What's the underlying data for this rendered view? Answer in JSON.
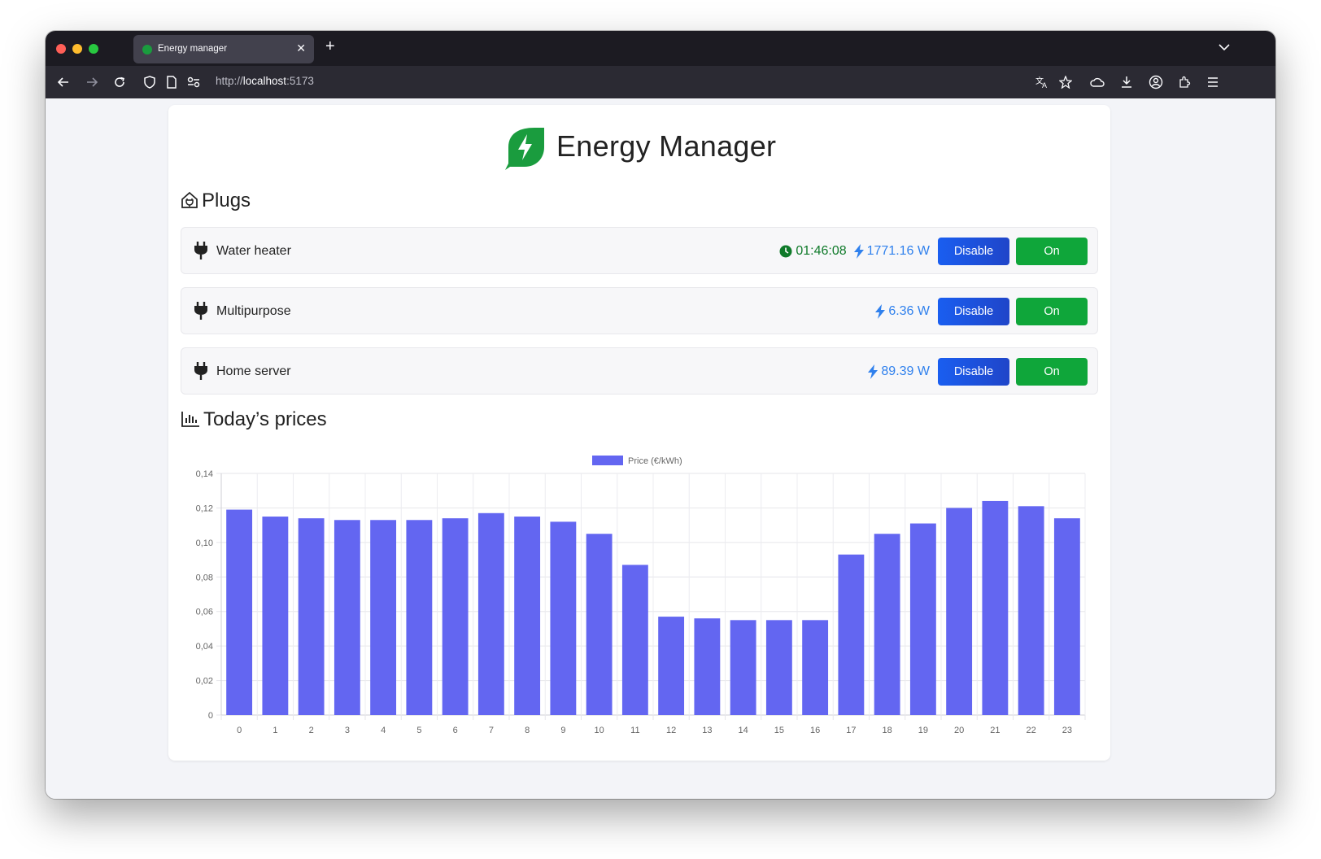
{
  "browser": {
    "tab_title": "Energy manager",
    "url_scheme": "http://",
    "url_host": "localhost",
    "url_port": ":5173"
  },
  "app": {
    "title": "Energy Manager",
    "plugs_heading": "Plugs",
    "prices_heading": "Today’s prices"
  },
  "plugs": [
    {
      "name": "Water heater",
      "timer": "01:46:08",
      "power": "1771.16 W",
      "disable_label": "Disable",
      "on_label": "On"
    },
    {
      "name": "Multipurpose",
      "timer": "",
      "power": "6.36 W",
      "disable_label": "Disable",
      "on_label": "On"
    },
    {
      "name": "Home server",
      "timer": "",
      "power": "89.39 W",
      "disable_label": "Disable",
      "on_label": "On"
    }
  ],
  "colors": {
    "accent_blue": "#2f80ed",
    "timer_green": "#0f7a2a",
    "on_green": "#0fa63a",
    "bar": "#6366f1",
    "logo_green": "#1a9c3e"
  },
  "chart_data": {
    "type": "bar",
    "categories": [
      "0",
      "1",
      "2",
      "3",
      "4",
      "5",
      "6",
      "7",
      "8",
      "9",
      "10",
      "11",
      "12",
      "13",
      "14",
      "15",
      "16",
      "17",
      "18",
      "19",
      "20",
      "21",
      "22",
      "23"
    ],
    "series": [
      {
        "name": "Price (€/kWh)",
        "values": [
          0.119,
          0.115,
          0.114,
          0.113,
          0.113,
          0.113,
          0.114,
          0.117,
          0.115,
          0.112,
          0.105,
          0.087,
          0.057,
          0.056,
          0.055,
          0.055,
          0.055,
          0.093,
          0.105,
          0.111,
          0.12,
          0.124,
          0.121,
          0.114
        ]
      }
    ],
    "yticks": [
      "0",
      "0,02",
      "0,04",
      "0,06",
      "0,08",
      "0,10",
      "0,12",
      "0,14"
    ],
    "ylim": [
      0,
      0.14
    ],
    "grid": true,
    "legend_position": "top-center"
  }
}
